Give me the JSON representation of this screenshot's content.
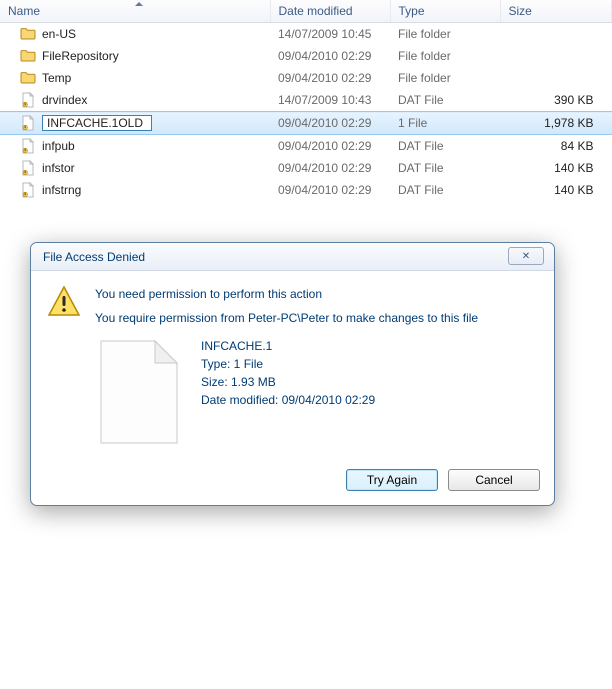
{
  "columns": {
    "name": "Name",
    "date": "Date modified",
    "type": "Type",
    "size": "Size"
  },
  "files": [
    {
      "name": "en-US",
      "date": "14/07/2009 10:45",
      "type": "File folder",
      "size": "",
      "kind": "folder"
    },
    {
      "name": "FileRepository",
      "date": "09/04/2010 02:29",
      "type": "File folder",
      "size": "",
      "kind": "folder"
    },
    {
      "name": "Temp",
      "date": "09/04/2010 02:29",
      "type": "File folder",
      "size": "",
      "kind": "folder"
    },
    {
      "name": "drvindex",
      "date": "14/07/2009 10:43",
      "type": "DAT File",
      "size": "390 KB",
      "kind": "file"
    },
    {
      "name": "INFCACHE.1OLD",
      "date": "09/04/2010 02:29",
      "type": "1 File",
      "size": "1,978 KB",
      "kind": "file",
      "selected": true,
      "renaming": true
    },
    {
      "name": "infpub",
      "date": "09/04/2010 02:29",
      "type": "DAT File",
      "size": "84 KB",
      "kind": "file"
    },
    {
      "name": "infstor",
      "date": "09/04/2010 02:29",
      "type": "DAT File",
      "size": "140 KB",
      "kind": "file"
    },
    {
      "name": "infstrng",
      "date": "09/04/2010 02:29",
      "type": "DAT File",
      "size": "140 KB",
      "kind": "file"
    }
  ],
  "dialog": {
    "title": "File Access Denied",
    "close_symbol": "✕",
    "line1": "You need permission to perform this action",
    "line2": "You require permission from Peter-PC\\Peter to make changes to this file",
    "file": {
      "name": "INFCACHE.1",
      "type_label": "Type: 1 File",
      "size_label": "Size: 1.93 MB",
      "date_label": "Date modified: 09/04/2010 02:29"
    },
    "try_again": "Try Again",
    "cancel": "Cancel"
  }
}
